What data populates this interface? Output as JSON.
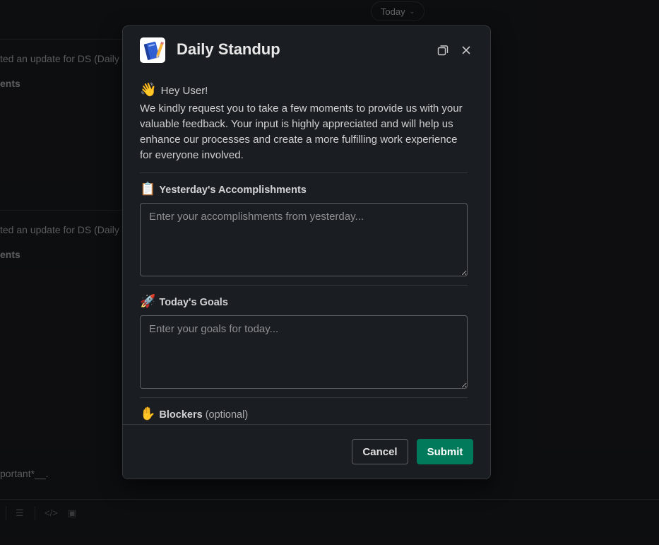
{
  "background": {
    "date_pill": "Today",
    "messages": [
      {
        "line1": "ted an update for DS (Daily",
        "line2": "ents"
      },
      {
        "line1": "ted an update for DS (Daily",
        "line2": "ents"
      }
    ],
    "footer_text": "portant*__."
  },
  "modal": {
    "title": "Daily Standup",
    "app_icon": "notebook-icon",
    "greeting_emoji": "👋",
    "greeting": "Hey User!",
    "intro": "We kindly request you to take a few moments to provide us with your valuable feedback. Your input is highly appreciated and will help us enhance our processes and create a more fulfilling work experience for everyone involved.",
    "fields": [
      {
        "emoji": "📋",
        "label": "Yesterday's Accomplishments",
        "placeholder": "Enter your accomplishments from yesterday...",
        "value": ""
      },
      {
        "emoji": "🚀",
        "label": "Today's Goals",
        "placeholder": "Enter your goals for today...",
        "value": ""
      },
      {
        "emoji": "✋",
        "label": "Blockers",
        "optional": "(optional)"
      }
    ],
    "buttons": {
      "cancel": "Cancel",
      "submit": "Submit"
    }
  },
  "colors": {
    "submit": "#007a5a",
    "modal_bg": "#1a1d21",
    "page_bg": "#151619"
  }
}
